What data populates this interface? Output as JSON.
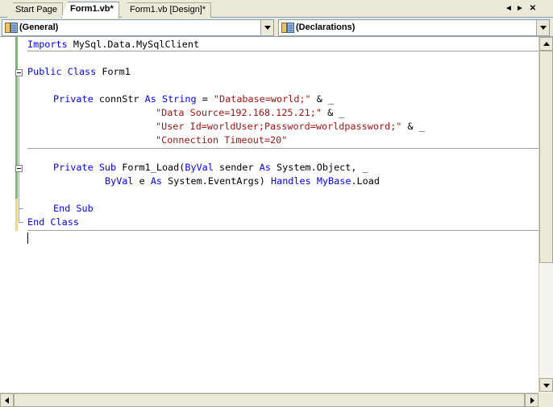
{
  "tabs": [
    {
      "label": "Start Page",
      "active": false
    },
    {
      "label": "Form1.vb*",
      "active": true
    },
    {
      "label": "Form1.vb [Design]*",
      "active": false
    }
  ],
  "tab_controls": {
    "scroll_left": "◄",
    "scroll_right": "►",
    "close": "✕"
  },
  "dropdowns": {
    "class_name": "(General)",
    "method_name": "(Declarations)"
  },
  "code": {
    "l1": {
      "kw1": "Imports",
      "t1": " MySql.Data.MySqlClient"
    },
    "l2": {
      "kw1": "Public",
      "kw2": "Class",
      "t1": " Form1"
    },
    "l3": {
      "kw1": "Private",
      "t1": " connStr ",
      "kw2": "As",
      "kw3": "String",
      "t2": " = ",
      "s1": "\"Database=world;\"",
      "t3": " & _"
    },
    "l4": {
      "s1": "\"Data Source=192.168.125.21;\"",
      "t1": " & _"
    },
    "l5": {
      "s1": "\"User Id=worldUser;Password=worldpassword;\"",
      "t1": " & _"
    },
    "l6": {
      "s1": "\"Connection Timeout=20\""
    },
    "l7": {
      "kw1": "Private",
      "kw2": "Sub",
      "t1": " Form1_Load(",
      "kw3": "ByVal",
      "t2": " sender ",
      "kw4": "As",
      "t3": " System.Object, _"
    },
    "l8": {
      "kw1": "ByVal",
      "t1": " e ",
      "kw2": "As",
      "t2": " System.EventArgs) ",
      "kw3": "Handles",
      "kw4": "MyBase",
      "t3": ".Load"
    },
    "l9": {
      "kw1": "End",
      "kw2": "Sub"
    },
    "l10": {
      "kw1": "End",
      "kw2": "Class"
    }
  },
  "colors": {
    "keyword": "#0000ff",
    "string": "#a31515",
    "saved_change_bar": "#73c26b",
    "unsaved_change_bar": "#f5d76e"
  }
}
